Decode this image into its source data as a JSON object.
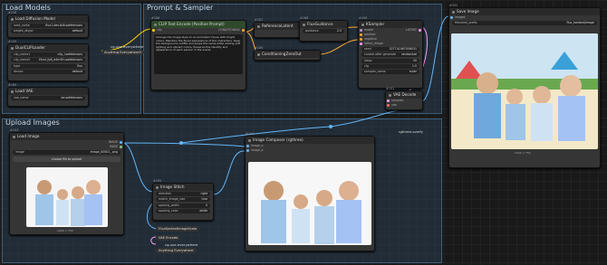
{
  "groups": {
    "load_models": "Load Models",
    "prompt_sampler": "Prompt & Sampler",
    "upload_images": "Upload Images"
  },
  "nodes": {
    "diffusion": {
      "id": "#158",
      "title": "Load Diffusion Model",
      "unet_label": "unet_name",
      "unet_value": "flux1-dev-fp8.safetensors",
      "dtype_label": "weight_dtype",
      "dtype_value": "default"
    },
    "clip": {
      "id": "#159",
      "title": "DualCLIPLoader",
      "clip1_label": "clip_name1",
      "clip1_value": "clip_l.safetensors",
      "clip2_label": "clip_name2",
      "clip2_value": "t5xxl_fp8_e4m3fn.safetensors",
      "type_label": "type",
      "type_value": "flux",
      "device_label": "device",
      "device_value": "default"
    },
    "vae": {
      "id": "#160",
      "title": "Load VAE",
      "vae_label": "vae_name",
      "vae_value": "ae.safetensors"
    },
    "anything_tag1": "Anything Everywhere3",
    "anything_tag1_top": "cg-use-everywhere",
    "clip_text": {
      "id": "#186",
      "title": "CLIP Text Encode (Positive Prompt)",
      "input": "clip",
      "output": "CONDITIONING",
      "text": "Change the image style to an animated movie with bright colors. Maintain the facial expressions of the characters. Keep the background, outfits and poses the same while adding soft lighting and vibrant colors. Preserve the identity and appearance of each person in the scene."
    },
    "ref_latent": {
      "id": "#187",
      "title": "ReferenceLatent",
      "input1": "conditioning",
      "input2": "latent"
    },
    "flux_guidance": {
      "id": "#188",
      "title": "FluxGuidance",
      "input": "conditioning",
      "output": "CONDITIONING",
      "guidance_label": "guidance",
      "guidance_value": "2.5"
    },
    "zero_out": {
      "id": "#189",
      "title": "ConditioningZeroOut"
    },
    "ksampler": {
      "id": "#190",
      "title": "KSampler",
      "model": "model",
      "positive": "positive",
      "negative": "negative",
      "latent": "latent_image",
      "output": "LATENT",
      "seed_label": "seed",
      "seed_value": "527741967056031",
      "control_label": "control after generate",
      "control_value": "randomize",
      "steps_label": "steps",
      "steps_value": "20",
      "cfg_label": "cfg",
      "cfg_value": "1.0",
      "sampler_label": "sampler_name",
      "sampler_value": "euler",
      "scheduler_label": "scheduler",
      "scheduler_value": "simple",
      "denoise_label": "denoise",
      "denoise_value": "1.00"
    },
    "vae_decode": {
      "id": "#191",
      "title": "VAE Decode",
      "samples": "samples",
      "vae": "vae",
      "output": "IMAGE"
    },
    "save_image": {
      "id": "#192",
      "title": "Save Image",
      "images": "images",
      "prefix_label": "filename_prefix",
      "prefix_value": "flux_kontext/image",
      "caption": "1024 × 752"
    },
    "load_image": {
      "id": "#193",
      "title": "Load Image",
      "image_label": "image",
      "image_value": "image_00001_.png",
      "upload": "choose file to upload",
      "out1": "IMAGE",
      "out2": "MASK",
      "caption": "1024 × 752"
    },
    "composer": {
      "id": "#194",
      "title": "Image Composer (rgthree)",
      "tag": "rgthree-comfy",
      "in1": "image_a",
      "in2": "image_b",
      "caption": "1024 × 752"
    },
    "stitch": {
      "id": "#195",
      "title": "Image Stitch",
      "image1": "image1",
      "image2": "image2",
      "output": "IMAGE",
      "dir_label": "direction",
      "dir_value": "right",
      "size_label": "match_image_size",
      "size_value": "true",
      "spacing_label": "spacing_width",
      "spacing_value": "0",
      "color_label": "spacing_color",
      "color_value": "white"
    },
    "flux_kontext": {
      "title": "FluxKontextImageScale"
    },
    "vae_encode": {
      "title": "VAE Encode"
    },
    "anything_tag2": "Anything Everywhere",
    "anything_tag2_top": "cg-use-everywhere"
  },
  "colors": {
    "group_border": "#3f5f7a",
    "model_wire": "#b39ddb",
    "clip_wire": "#ffd500",
    "cond_wire": "#ffa931",
    "latent_wire": "#ff9cf9",
    "image_wire": "#64b5f6",
    "vae_wire": "#ff6e6e",
    "accent_green": "#5a8a4e",
    "accent_red": "#a04040"
  },
  "icons": [
    "dot-icon"
  ]
}
